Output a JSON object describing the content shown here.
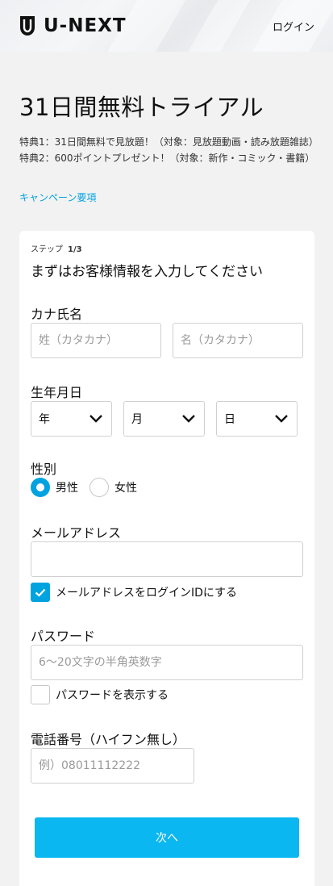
{
  "header": {
    "brand": "U-NEXT",
    "login_label": "ログイン"
  },
  "page": {
    "title": "31日間無料トライアル",
    "benefits": [
      "特典1：31日間無料で見放題！（対象：見放題動画・読み放題雑誌）",
      "特典2：600ポイントプレゼント！（対象：新作・コミック・書籍）"
    ],
    "campaign_link": "キャンペーン要項"
  },
  "form": {
    "step_label": "ステップ",
    "step_value": "1/3",
    "heading": "まずはお客様情報を入力してください",
    "kana_name": {
      "label": "カナ氏名",
      "last_placeholder": "姓（カタカナ）",
      "first_placeholder": "名（カタカナ）"
    },
    "birthdate": {
      "label": "生年月日",
      "year": "年",
      "month": "月",
      "day": "日"
    },
    "gender": {
      "label": "性別",
      "options": [
        "男性",
        "女性"
      ],
      "selected": "男性"
    },
    "email": {
      "label": "メールアドレス",
      "value": "",
      "use_as_login_label": "メールアドレスをログインIDにする",
      "use_as_login_checked": true
    },
    "password": {
      "label": "パスワード",
      "placeholder": "6〜20文字の半角英数字",
      "show_label": "パスワードを表示する",
      "show_checked": false
    },
    "phone": {
      "label": "電話番号（ハイフン無し）",
      "placeholder": "例）08011112222"
    },
    "next_label": "次へ"
  },
  "colors": {
    "accent": "#00a3e0",
    "button": "#0ab7f0",
    "background": "#f2f2f2"
  }
}
